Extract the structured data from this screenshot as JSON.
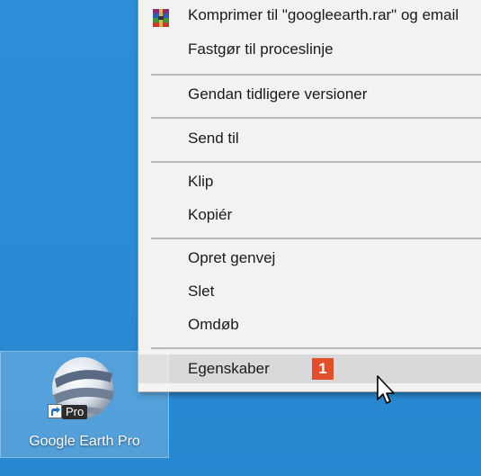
{
  "menu": {
    "items": [
      {
        "label": "Komprimer til \"googleearth.rar\" og email"
      },
      {
        "label": "Fastgør til proceslinje"
      },
      {
        "label": "Gendan tidligere versioner"
      },
      {
        "label": "Send til"
      },
      {
        "label": "Klip"
      },
      {
        "label": "Kopiér"
      },
      {
        "label": "Opret genvej"
      },
      {
        "label": "Slet"
      },
      {
        "label": "Omdøb"
      },
      {
        "label": "Egenskaber",
        "highlighted": true,
        "step_badge": "1"
      }
    ]
  },
  "desktop_icon": {
    "label": "Google Earth Pro",
    "overlay_text": "Pro",
    "icon": "google-earth-icon",
    "shortcut_icon": "shortcut-arrow-icon"
  },
  "colors": {
    "desktop_bg": "#2b8ed6",
    "menu_bg": "#f2f2f2",
    "highlight": "#d9d9d9",
    "badge": "#e1502a"
  }
}
